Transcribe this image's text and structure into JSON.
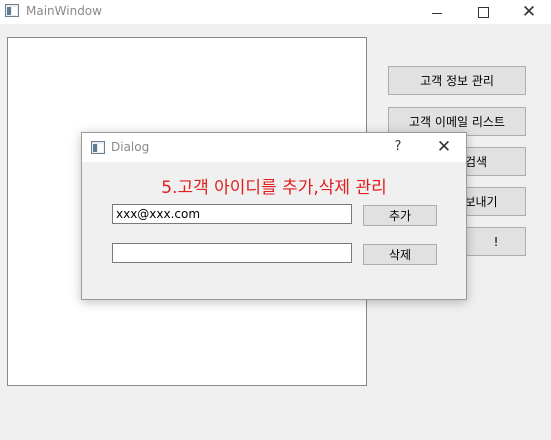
{
  "window": {
    "title": "MainWindow",
    "minimize_glyph": "—",
    "maximize_glyph": "☐",
    "close_glyph": "✕"
  },
  "sidebar": {
    "buttons": [
      {
        "label": "고객 정보 관리"
      },
      {
        "label": "고객 이메일 리스트"
      },
      {
        "label": "검색"
      },
      {
        "label": "보내기"
      },
      {
        "label": "!"
      }
    ]
  },
  "dialog": {
    "title": "Dialog",
    "help_glyph": "?",
    "close_glyph": "✕",
    "heading": "5.고객 아이디를 추가,삭제 관리",
    "heading_color": "#e01e1e",
    "add_input": {
      "value": "xxx@xxx.com"
    },
    "add_button": "추가",
    "delete_input": {
      "value": ""
    },
    "delete_button": "삭제"
  }
}
